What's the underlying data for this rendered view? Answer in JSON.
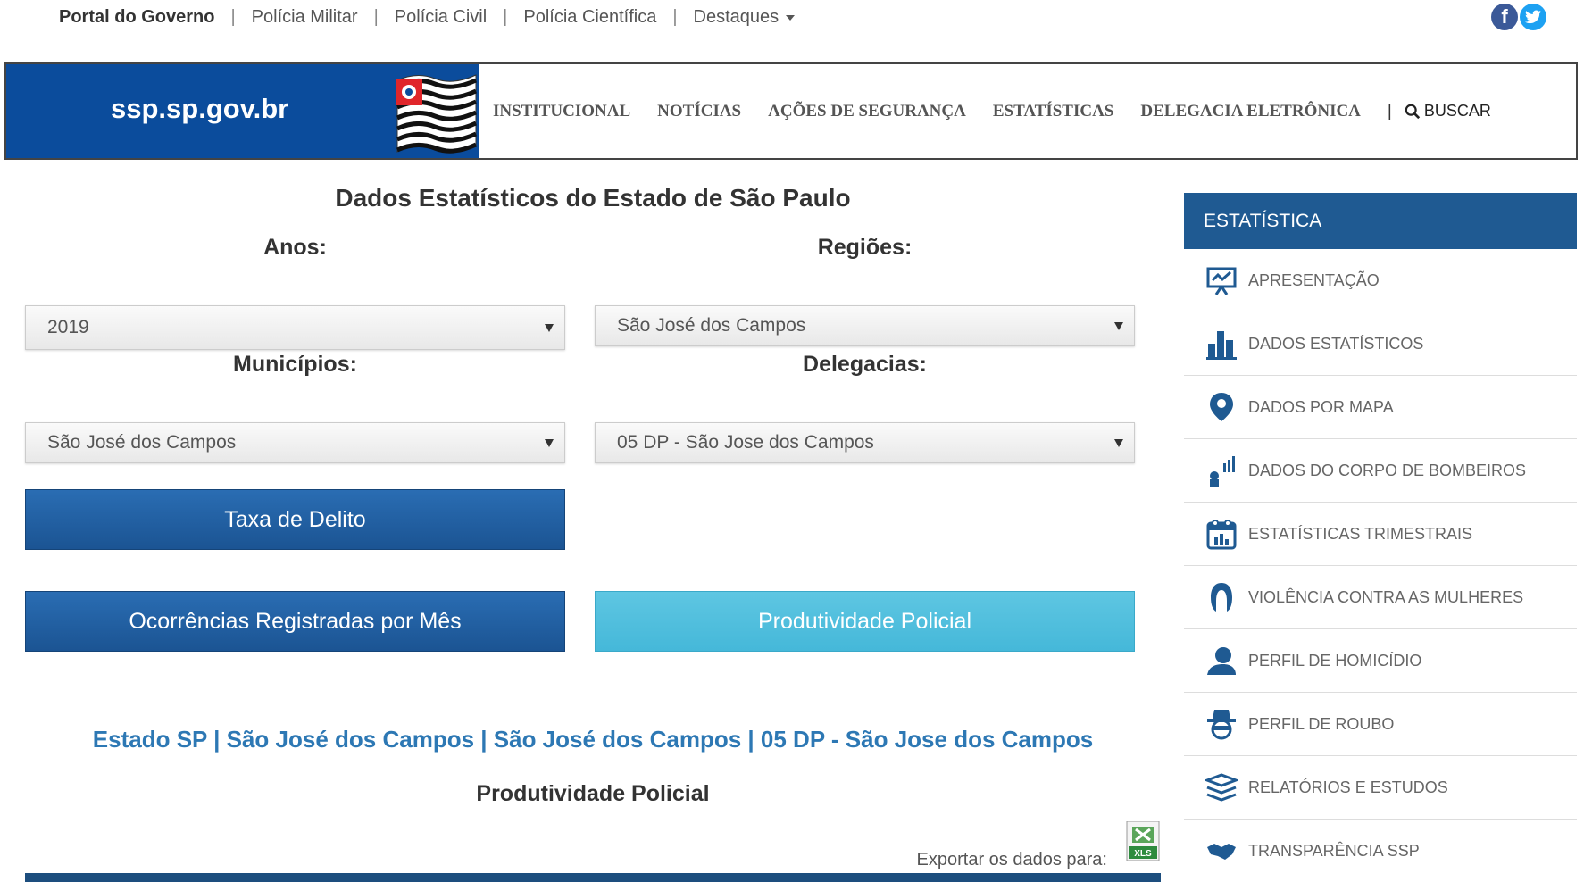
{
  "topbar": {
    "brand": "Portal do Governo",
    "links": [
      "Polícia Militar",
      "Polícia Civil",
      "Polícia Científica"
    ],
    "destaques": "Destaques",
    "social": {
      "facebook": "f",
      "twitter": "t"
    }
  },
  "header": {
    "logo_text": "ssp.sp.gov.br",
    "nav": [
      "INSTITUCIONAL",
      "NOTÍCIAS",
      "AÇÕES DE SEGURANÇA",
      "ESTATÍSTICAS",
      "DELEGACIA ELETRÔNICA"
    ],
    "search_label": "BUSCAR",
    "brand_color": "#0b4c9c"
  },
  "main": {
    "title": "Dados Estatísticos do Estado de São Paulo",
    "filters": {
      "anos": {
        "label": "Anos:",
        "value": "2019"
      },
      "regioes": {
        "label": "Regiões:",
        "value": "São José dos Campos"
      },
      "municipios": {
        "label": "Municípios:",
        "value": "São José dos Campos"
      },
      "delegacias": {
        "label": "Delegacias:",
        "value": "05 DP - São Jose dos Campos"
      }
    },
    "buttons": {
      "taxa": "Taxa de Delito",
      "ocorrencias": "Ocorrências Registradas por Mês",
      "produtividade": "Produtividade Policial"
    },
    "breadcrumb": "Estado SP | São José dos Campos | São José dos Campos | 05 DP - São Jose dos Campos",
    "section_title": "Produtividade Policial",
    "export_label": "Exportar os dados para:",
    "xls_label": "XLS"
  },
  "sidebar": {
    "title": "ESTATÍSTICA",
    "items": [
      {
        "label": "APRESENTAÇÃO",
        "icon": "presentation-icon"
      },
      {
        "label": "DADOS ESTATÍSTICOS",
        "icon": "bar-chart-icon"
      },
      {
        "label": "DADOS POR MAPA",
        "icon": "map-pin-icon"
      },
      {
        "label": "DADOS DO CORPO DE BOMBEIROS",
        "icon": "firefighter-icon"
      },
      {
        "label": "ESTATÍSTICAS TRIMESTRAIS",
        "icon": "calendar-icon"
      },
      {
        "label": "VIOLÊNCIA CONTRA AS MULHERES",
        "icon": "woman-icon"
      },
      {
        "label": "PERFIL DE HOMICÍDIO",
        "icon": "person-icon"
      },
      {
        "label": "PERFIL DE ROUBO",
        "icon": "robber-icon"
      },
      {
        "label": "RELATÓRIOS E ESTUDOS",
        "icon": "documents-icon"
      },
      {
        "label": "TRANSPARÊNCIA SSP",
        "icon": "handshake-icon"
      }
    ]
  }
}
